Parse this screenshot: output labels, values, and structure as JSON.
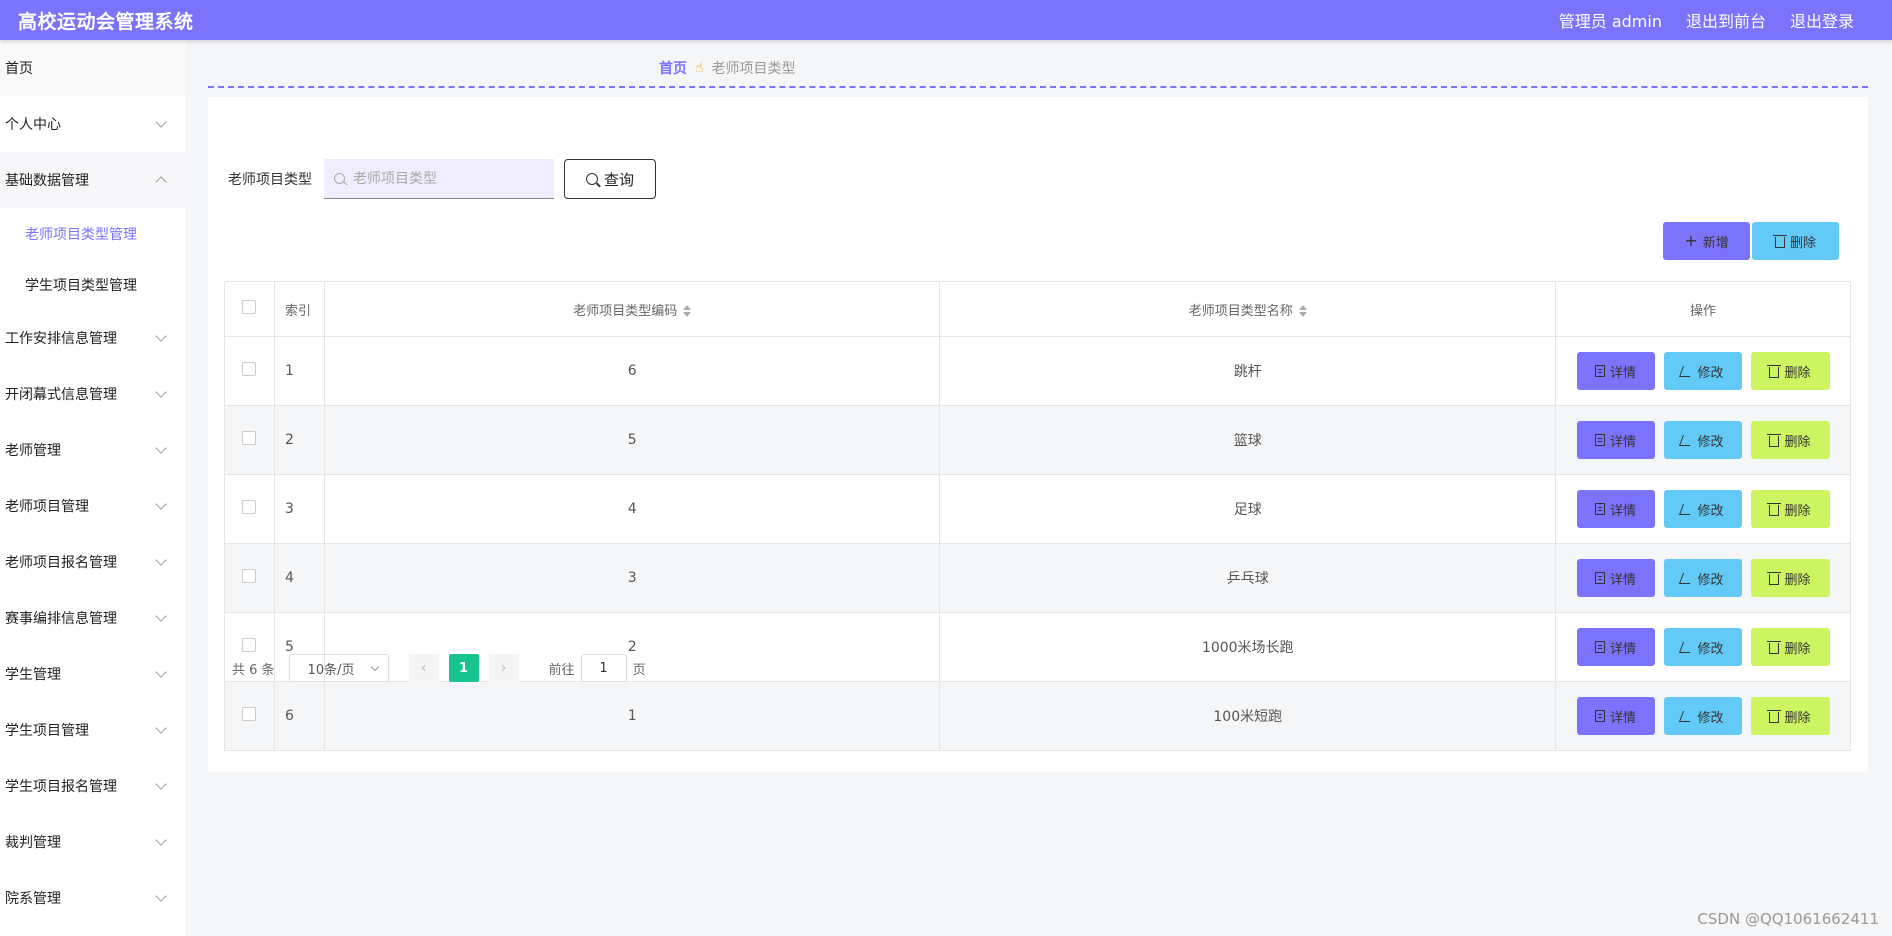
{
  "app": {
    "title": "高校运动会管理系统",
    "user_label": "管理员 admin",
    "front_link": "退出到前台",
    "logout_link": "退出登录"
  },
  "sidebar": {
    "items": [
      {
        "label": "首页"
      },
      {
        "label": "个人中心"
      },
      {
        "label": "基础数据管理"
      },
      {
        "label": "工作安排信息管理"
      },
      {
        "label": "开闭幕式信息管理"
      },
      {
        "label": "老师管理"
      },
      {
        "label": "老师项目管理"
      },
      {
        "label": "老师项目报名管理"
      },
      {
        "label": "赛事编排信息管理"
      },
      {
        "label": "学生管理"
      },
      {
        "label": "学生项目管理"
      },
      {
        "label": "学生项目报名管理"
      },
      {
        "label": "裁判管理"
      },
      {
        "label": "院系管理"
      }
    ],
    "sub_items": [
      {
        "label": "老师项目类型管理"
      },
      {
        "label": "学生项目类型管理"
      }
    ]
  },
  "breadcrumb": {
    "home": "首页",
    "separator": "☝",
    "current": "老师项目类型"
  },
  "search": {
    "label": "老师项目类型",
    "placeholder": "老师项目类型",
    "query_button": "查询"
  },
  "toolbar": {
    "add_label": "新增",
    "delete_label": "删除"
  },
  "table": {
    "headers": {
      "index": "索引",
      "code": "老师项目类型编码",
      "name": "老师项目类型名称",
      "ops": "操作"
    },
    "row_actions": {
      "detail": "详情",
      "edit": "修改",
      "delete": "删除"
    },
    "rows": [
      {
        "index": "1",
        "code": "6",
        "name": "跳杆"
      },
      {
        "index": "2",
        "code": "5",
        "name": "篮球"
      },
      {
        "index": "3",
        "code": "4",
        "name": "足球"
      },
      {
        "index": "4",
        "code": "3",
        "name": "乒乓球"
      },
      {
        "index": "5",
        "code": "2",
        "name": "1000米场长跑"
      },
      {
        "index": "6",
        "code": "1",
        "name": "100米短跑"
      }
    ]
  },
  "pagination": {
    "total": "共 6 条",
    "page_size": "10条/页",
    "current_page": "1",
    "goto_label": "前往",
    "goto_value": "1",
    "page_suffix": "页"
  },
  "watermark": "CSDN @QQ1061662411",
  "colors": {
    "primary": "#7b73f9",
    "info": "#63c9f7",
    "danger": "#cdf561",
    "page_active": "#17c48f"
  }
}
